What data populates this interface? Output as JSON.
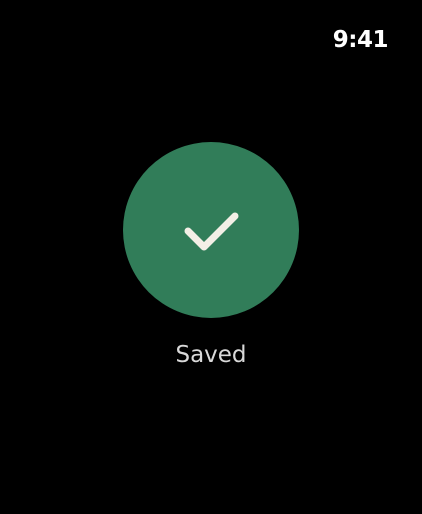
{
  "status_bar": {
    "time": "9:41"
  },
  "confirmation": {
    "icon": "checkmark-icon",
    "label": "Saved",
    "colors": {
      "circle": "#317d59",
      "check": "#f3efe6",
      "label": "#d9d9d9",
      "background": "#000000"
    }
  }
}
